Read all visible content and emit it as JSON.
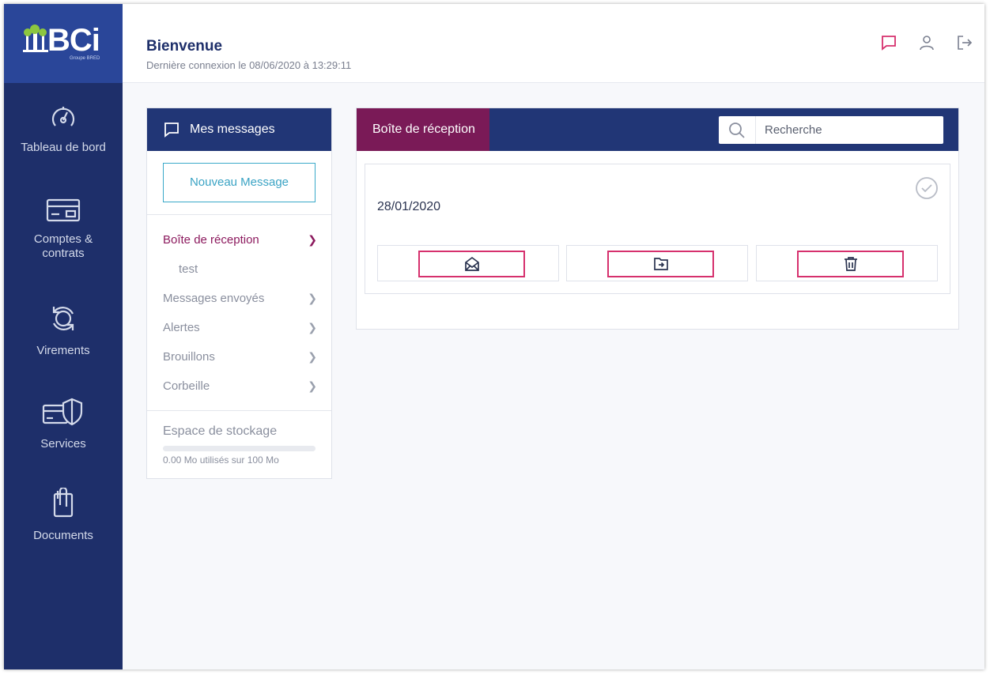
{
  "brand": {
    "logo_text": "BCi",
    "logo_subtitle": "Groupe BRED",
    "accent": "#2a4699",
    "sidebar_bg": "#1e2f6a",
    "highlight": "#8c1a5e"
  },
  "sidebar": {
    "items": [
      {
        "label": "Tableau de bord",
        "icon": "dashboard-gauge-icon"
      },
      {
        "label": "Comptes &\ncontrats",
        "icon": "card-icon"
      },
      {
        "label": "Virements",
        "icon": "transfer-cycle-icon"
      },
      {
        "label": "Services",
        "icon": "shield-card-icon"
      },
      {
        "label": "Documents",
        "icon": "clipboard-icon"
      }
    ]
  },
  "header": {
    "title": "Bienvenue",
    "last_login": "Dernière connexion le 08/06/2020 à 13:29:11",
    "icons": [
      "chat-icon",
      "user-icon",
      "logout-icon"
    ]
  },
  "messages_panel": {
    "title": "Mes messages",
    "new_message_label": "Nouveau Message",
    "folders": [
      {
        "label": "Boîte de réception",
        "active": true
      },
      {
        "label": "Messages envoyés",
        "active": false
      },
      {
        "label": "Alertes",
        "active": false
      },
      {
        "label": "Brouillons",
        "active": false
      },
      {
        "label": "Corbeille",
        "active": false
      }
    ],
    "subfolder": "test",
    "storage": {
      "label": "Espace de stockage",
      "usage_text": "0.00 Mo utilisés sur 100 Mo",
      "used_fraction": 0
    }
  },
  "inbox": {
    "tab_label": "Boîte de réception",
    "search_placeholder": "Recherche",
    "message": {
      "date": "28/01/2020"
    },
    "actions": [
      "mark-read-envelope-icon",
      "move-to-folder-icon",
      "trash-icon"
    ]
  }
}
